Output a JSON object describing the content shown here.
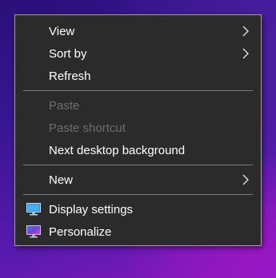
{
  "context_menu": {
    "items": {
      "view": {
        "label": "View",
        "submenu_icon": "chevron-right-icon"
      },
      "sort_by": {
        "label": "Sort by",
        "submenu_icon": "chevron-right-icon"
      },
      "refresh": {
        "label": "Refresh"
      },
      "paste": {
        "label": "Paste",
        "enabled": false
      },
      "paste_shortcut": {
        "label": "Paste shortcut",
        "enabled": false
      },
      "next_background": {
        "label": "Next desktop background"
      },
      "new": {
        "label": "New",
        "submenu_icon": "chevron-right-icon"
      },
      "display_settings": {
        "label": "Display settings",
        "icon": "monitor-icon"
      },
      "personalize": {
        "label": "Personalize",
        "icon": "personalize-monitor-icon"
      }
    }
  },
  "colors": {
    "menu_background": "#2b2b2b",
    "menu_border": "#a0a0a0",
    "text": "#ffffff",
    "disabled_text": "#6d6d6d",
    "separator": "#7a7a7a",
    "desktop_accent": "#8c17c0"
  }
}
